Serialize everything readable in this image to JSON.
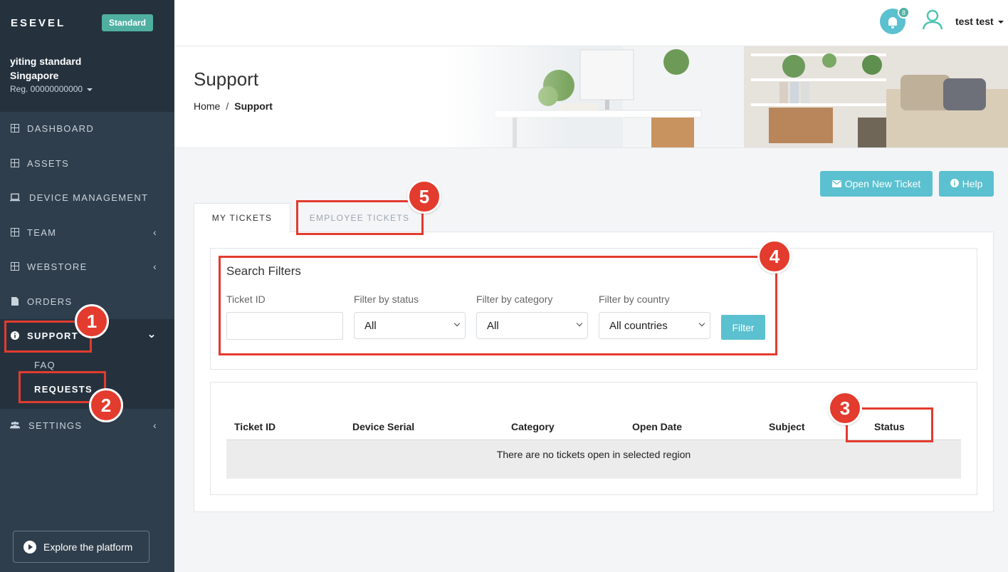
{
  "sidebar": {
    "logo": "ESEVEL",
    "plan_badge": "Standard",
    "company_line1": "yiting standard",
    "company_line2": "Singapore",
    "reg": "Reg. 00000000000",
    "items": [
      {
        "label": "DASHBOARD",
        "icon": "grid-icon"
      },
      {
        "label": "ASSETS",
        "icon": "grid-icon"
      },
      {
        "label": "DEVICE MANAGEMENT",
        "icon": "laptop-icon"
      },
      {
        "label": "TEAM",
        "icon": "grid-icon",
        "chevron": "‹"
      },
      {
        "label": "WEBSTORE",
        "icon": "grid-icon",
        "chevron": "‹"
      },
      {
        "label": "ORDERS",
        "icon": "document-icon"
      },
      {
        "label": "SUPPORT",
        "icon": "info-icon",
        "chevron": "⌄"
      },
      {
        "label": "SETTINGS",
        "icon": "users-icon",
        "chevron": "‹"
      }
    ],
    "sub_items": [
      {
        "label": "FAQ"
      },
      {
        "label": "REQUESTS"
      }
    ],
    "explore_label": "Explore the platform"
  },
  "header": {
    "notification_count": "8",
    "user_name": "test test"
  },
  "hero": {
    "title": "Support",
    "breadcrumb_home": "Home",
    "breadcrumb_sep": "/",
    "breadcrumb_current": "Support"
  },
  "actions": {
    "open_ticket": "Open New Ticket",
    "help": "Help"
  },
  "tabs": [
    {
      "label": "MY TICKETS",
      "active": true
    },
    {
      "label": "EMPLOYEE TICKETS",
      "active": false
    }
  ],
  "filters": {
    "title": "Search Filters",
    "ticket_id_label": "Ticket ID",
    "ticket_id_value": "",
    "status_label": "Filter by status",
    "status_value": "All",
    "category_label": "Filter by category",
    "category_value": "All",
    "country_label": "Filter by country",
    "country_value": "All countries",
    "filter_button": "Filter"
  },
  "table": {
    "columns": [
      "Ticket ID",
      "Device Serial",
      "Category",
      "Open Date",
      "Subject",
      "Status"
    ],
    "empty_message": "There are no tickets open in selected region"
  },
  "annotations": [
    "1",
    "2",
    "3",
    "4",
    "5"
  ],
  "colors": {
    "accent": "#5bc0cf",
    "sidebar": "#2f3e4c",
    "badge": "#4fb0a2",
    "annotation": "#e33b2e"
  }
}
